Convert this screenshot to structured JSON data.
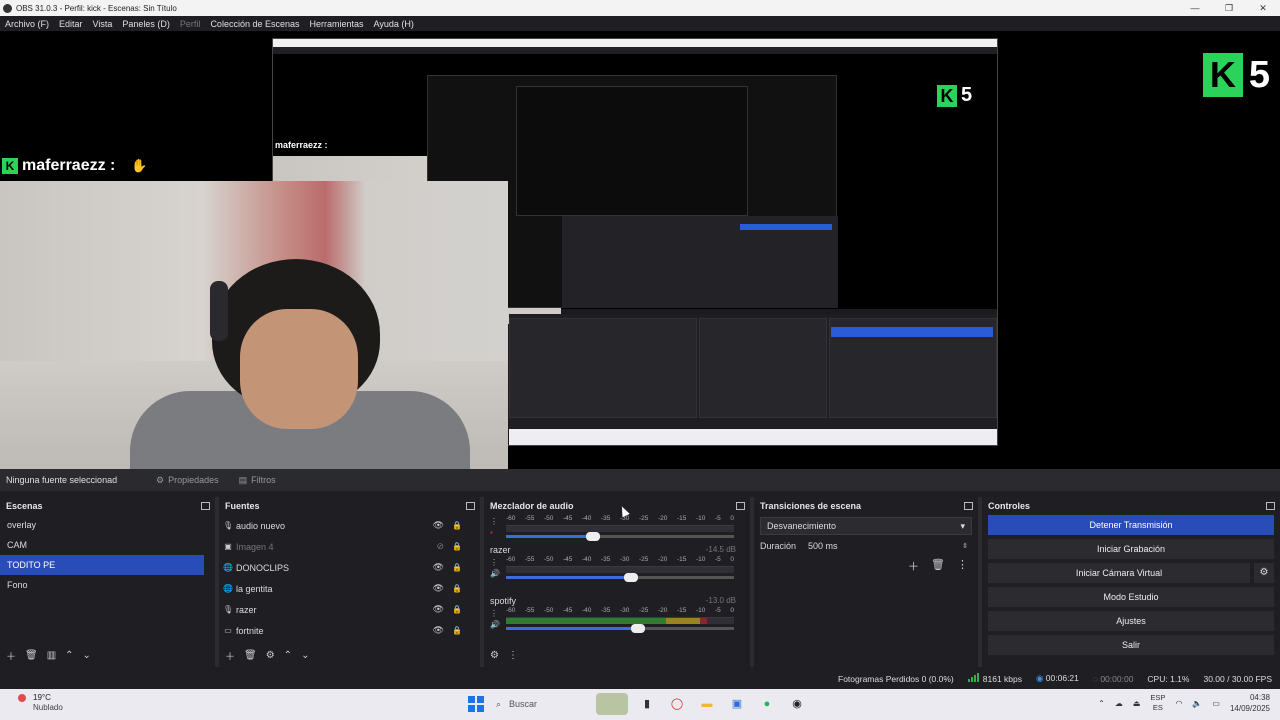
{
  "window": {
    "title": "OBS 31.0.3 - Perfil: kick - Escenas: Sin Título",
    "controls": [
      "—",
      "❐",
      "✕"
    ]
  },
  "menu": [
    {
      "label": "Archivo (F)",
      "enabled": true
    },
    {
      "label": "Editar",
      "enabled": true
    },
    {
      "label": "Vista",
      "enabled": true
    },
    {
      "label": "Paneles (D)",
      "enabled": true
    },
    {
      "label": "Perfil",
      "enabled": false
    },
    {
      "label": "Colección de Escenas",
      "enabled": true
    },
    {
      "label": "Herramientas",
      "enabled": true
    },
    {
      "label": "Ayuda (H)",
      "enabled": true
    }
  ],
  "preview": {
    "chat_user": "maferraezz :",
    "nested_chat_user": "maferraezz :",
    "kick_letter": "K",
    "kick_number": "5"
  },
  "source_toolbar": {
    "no_source": "Ninguna fuente seleccionad",
    "properties": "Propiedades",
    "filters": "Filtros"
  },
  "scenes": {
    "title": "Escenas",
    "items": [
      {
        "label": "overlay",
        "selected": false
      },
      {
        "label": "CAM",
        "selected": false
      },
      {
        "label": "TODITO PE",
        "selected": true
      },
      {
        "label": "Fono",
        "selected": false
      }
    ]
  },
  "sources": {
    "title": "Fuentes",
    "items": [
      {
        "label": "audio nuevo",
        "icon": "microphone-icon",
        "visible": true
      },
      {
        "label": "Imagen 4",
        "icon": "image-icon",
        "visible": false
      },
      {
        "label": "DONOCLIPS",
        "icon": "browser-icon",
        "visible": true
      },
      {
        "label": "la gentita",
        "icon": "browser-icon",
        "visible": true
      },
      {
        "label": "razer",
        "icon": "microphone-icon",
        "visible": true
      },
      {
        "label": "fortnite",
        "icon": "window-capture-icon",
        "visible": true
      }
    ]
  },
  "mixer": {
    "title": "Mezclador de audio",
    "scale": [
      "-60",
      "-55",
      "-50",
      "-45",
      "-40",
      "-35",
      "-30",
      "-25",
      "-20",
      "-15",
      "-10",
      "-5",
      "0"
    ],
    "channels": [
      {
        "name": "",
        "db": "",
        "level": 0.0,
        "fader": 0.38,
        "muted_icon": true
      },
      {
        "name": "razer",
        "db": "-14.5 dB",
        "level": 0.0,
        "fader": 0.55,
        "muted_icon": false
      },
      {
        "name": "spotify",
        "db": "-13.0 dB",
        "level": 0.88,
        "fader": 0.58,
        "muted_icon": false
      }
    ]
  },
  "transitions": {
    "title": "Transiciones de escena",
    "selected": "Desvanecimiento",
    "duration_label": "Duración",
    "duration_value": "500 ms"
  },
  "controls": {
    "title": "Controles",
    "buttons": [
      {
        "label": "Detener Transmisión",
        "primary": true
      },
      {
        "label": "Iniciar Grabación",
        "primary": false
      },
      {
        "label": "Iniciar Cámara Virtual",
        "primary": false
      },
      {
        "label": "Modo Estudio",
        "primary": false
      },
      {
        "label": "Ajustes",
        "primary": false
      },
      {
        "label": "Salir",
        "primary": false
      }
    ]
  },
  "status": {
    "dropped_frames": "Fotogramas Perdidos 0 (0.0%)",
    "bitrate": "8161 kbps",
    "live_time": "00:06:21",
    "rec_time": "00:00:00",
    "cpu": "CPU: 1.1%",
    "fps": "30.00 / 30.00 FPS"
  },
  "taskbar": {
    "temperature": "19°C",
    "condition": "Nublado",
    "search_placeholder": "Buscar",
    "lang_top": "ESP",
    "lang_bottom": "ES",
    "time": "04:38",
    "date": "14/09/2025"
  },
  "colors": {
    "accent_blue": "#284cb8",
    "kick_green": "#2cd35a",
    "meter_green": "#2f7d2f"
  }
}
